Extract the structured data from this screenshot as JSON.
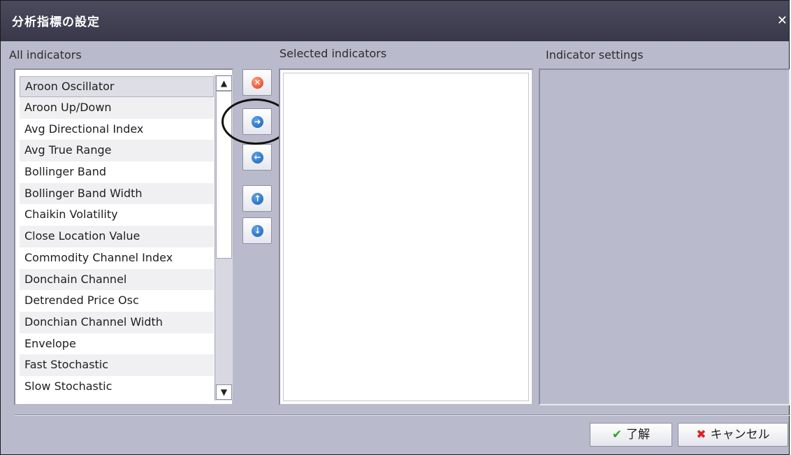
{
  "dialog": {
    "title": "分析指標の設定",
    "close_glyph": "✕"
  },
  "columns": {
    "all": "All indicators",
    "selected": "Selected indicators",
    "settings": "Indicator settings"
  },
  "all_indicators": [
    "Aroon Oscillator",
    "Aroon Up/Down",
    "Avg Directional Index",
    "Avg True Range",
    "Bollinger Band",
    "Bollinger Band Width",
    "Chaikin Volatility",
    "Close Location Value",
    "Commodity Channel Index",
    "Donchain Channel",
    "Detrended Price Osc",
    "Donchian Channel Width",
    "Envelope",
    "Fast Stochastic",
    "Slow Stochastic"
  ],
  "selected_item": "Aroon Oscillator",
  "scrollbar": {
    "up_glyph": "▲",
    "down_glyph": "▼"
  },
  "side_buttons": {
    "remove_glyph": "✕",
    "add_glyph": "➜",
    "back_glyph": "←",
    "up_glyph": "↑",
    "down_glyph": "↓"
  },
  "footer": {
    "ok_label": "了解",
    "cancel_label": "キャンセル",
    "ok_glyph": "✔",
    "cancel_glyph": "✖"
  },
  "colors": {
    "titlebar": "#3c3c4f",
    "dialog_bg": "#b9bbcc",
    "accent_blue": "#1b5fb2",
    "remove_red": "#d9401e"
  }
}
